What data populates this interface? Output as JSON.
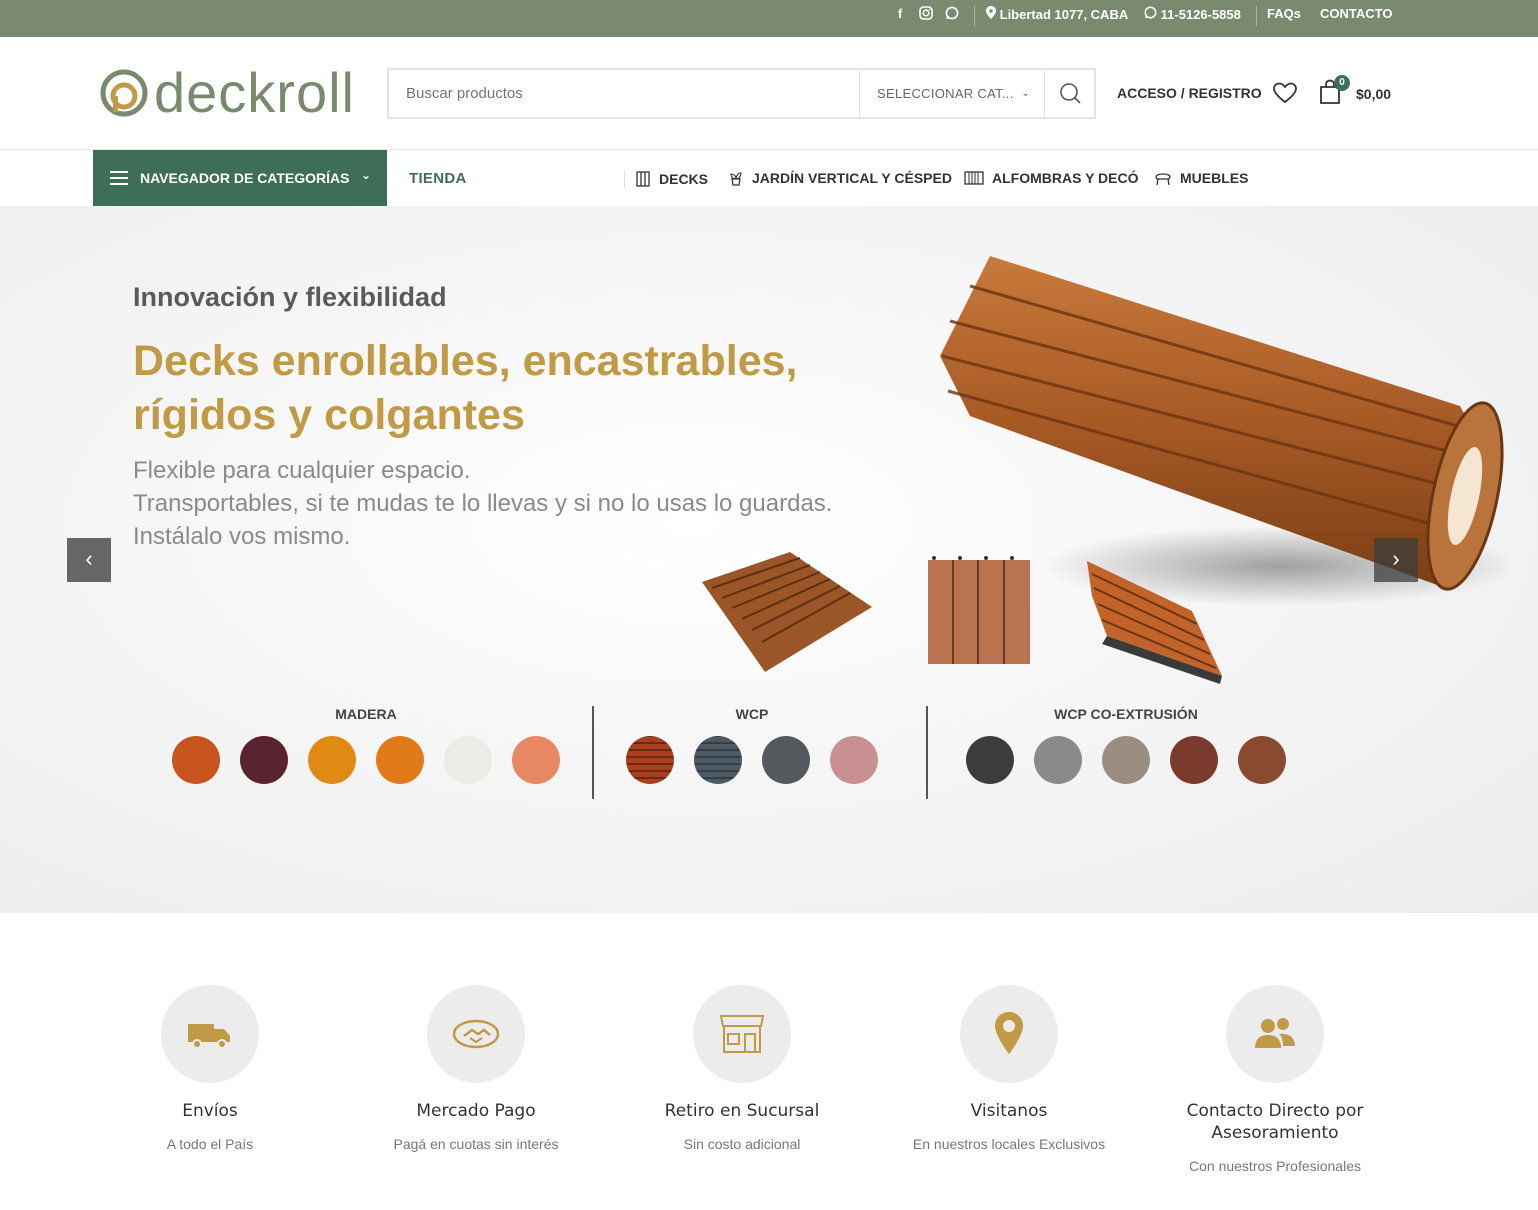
{
  "topbar": {
    "address": "Libertad 1077, CABA",
    "phone": "11-5126-5858",
    "faq": "FAQs",
    "contact": "CONTACTO"
  },
  "header": {
    "logo_text": "deckroll",
    "search_placeholder": "Buscar productos",
    "category_select": "SELECCIONAR CAT...",
    "account": "ACCESO / REGISTRO",
    "cart_count": "0",
    "cart_total": "$0,00"
  },
  "nav": {
    "category_browser": "NAVEGADOR DE CATEGORÍAS",
    "shop": "TIENDA",
    "items": [
      {
        "label": "DECKS",
        "icon": "deck-icon"
      },
      {
        "label": "JARDÍN VERTICAL Y CÉSPED",
        "icon": "plant-icon"
      },
      {
        "label": "ALFOMBRAS Y DECÓ",
        "icon": "rug-icon"
      },
      {
        "label": "MUEBLES",
        "icon": "chair-icon"
      }
    ]
  },
  "hero": {
    "eyebrow": "Innovación y flexibilidad",
    "headline_1": "Decks enrollables, encastrables,",
    "headline_2": "rígidos y colgantes",
    "desc_1": "Flexible para cualquier espacio.",
    "desc_2": "Transportables, si te mudas te lo llevas y si no lo usas lo guardas.",
    "desc_3": "Instálalo vos mismo.",
    "groups": [
      {
        "title": "MADERA",
        "colors": [
          "#c8551e",
          "#5a2330",
          "#e08a14",
          "#e07a18",
          "#ecebe6",
          "#e88862"
        ]
      },
      {
        "title": "WCP",
        "colors": [
          "#a8401f",
          "#4d5a64",
          "#55585c",
          "#c89090"
        ]
      },
      {
        "title": "WCP CO-EXTRUSIÓN",
        "colors": [
          "#3c3c3c",
          "#8a8a8a",
          "#9a8e82",
          "#7a3a2c",
          "#8a4a30"
        ]
      }
    ]
  },
  "features": [
    {
      "title": "Envíos",
      "subtitle": "A todo el País",
      "icon": "truck-icon"
    },
    {
      "title": "Mercado Pago",
      "subtitle": "Pagá en cuotas sin interés",
      "icon": "handshake-icon"
    },
    {
      "title": "Retiro en Sucursal",
      "subtitle": "Sin costo adicional",
      "icon": "store-icon"
    },
    {
      "title": "Visitanos",
      "subtitle": "En nuestros locales Exclusivos",
      "icon": "location-pin-icon"
    },
    {
      "title": "Contacto Directo por Asesoramiento",
      "subtitle": "Con nuestros Profesionales",
      "icon": "users-icon"
    }
  ],
  "colors": {
    "topbar": "#7a8a6e",
    "brand_green": "#3f6e58",
    "gold": "#c09a45"
  }
}
